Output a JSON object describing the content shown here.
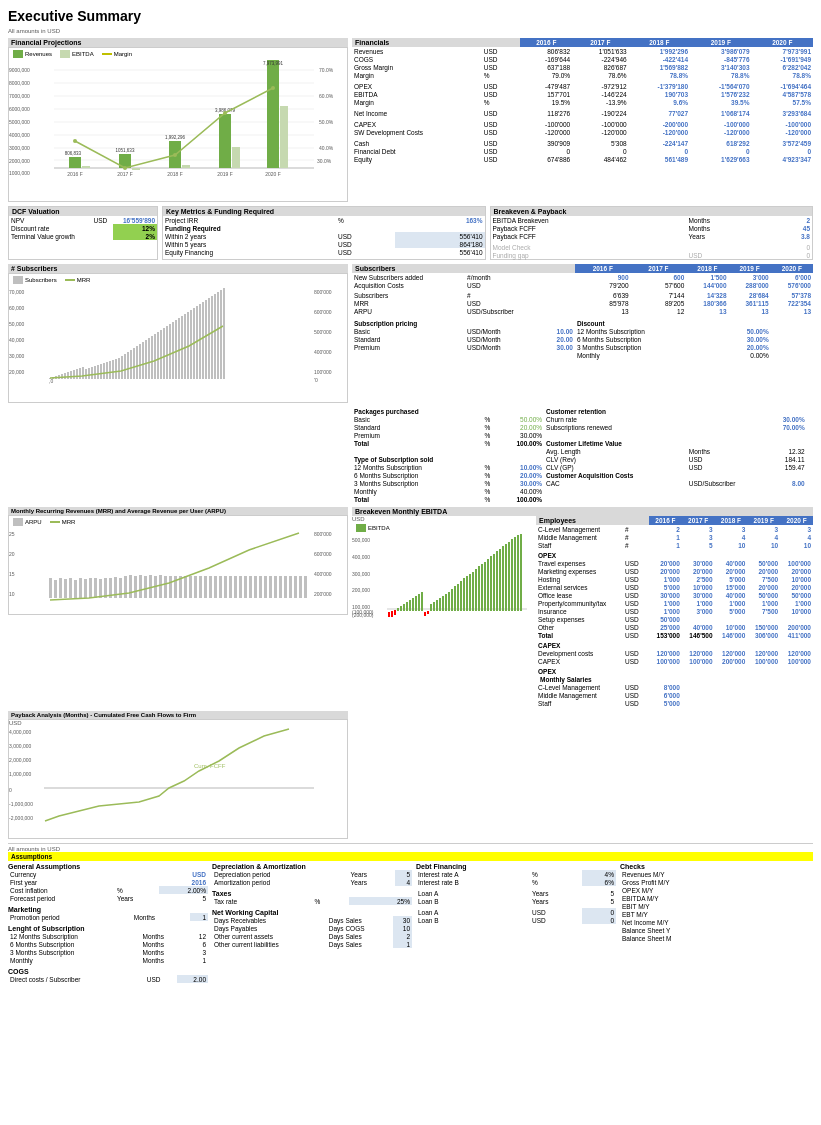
{
  "title": "Executive Summary",
  "currency_note": "All amounts in USD",
  "sections": {
    "financial_projections": {
      "label": "Financial Projections",
      "y_axis_label": "USD",
      "legend": [
        "Revenues",
        "EBITDA",
        "Margin"
      ],
      "bars": [
        {
          "year": "2016 F",
          "revenue": 806833,
          "ebitda": 157701,
          "margin": 19.5
        },
        {
          "year": "2017 F",
          "revenue": 1051633,
          "ebitda": -146224,
          "margin": -13.9
        },
        {
          "year": "2018 F",
          "revenue": 1992296,
          "ebitda": 190703,
          "margin": 9.6
        },
        {
          "year": "2019 F",
          "revenue": 3986079,
          "ebitda": 1576232,
          "margin": 39.5
        },
        {
          "year": "2020 F",
          "revenue": 7973991,
          "ebitda": 4587578,
          "margin": 57.5
        }
      ]
    },
    "financials": {
      "label": "Financials",
      "years": [
        "2016 F",
        "2017 F",
        "2018 F",
        "2019 F",
        "2020 F"
      ],
      "rows": [
        {
          "label": "Revenues",
          "unit": "USD",
          "values": [
            "806'832",
            "1'051'633",
            "1'992'296",
            "3'986'079",
            "7'973'991"
          ]
        },
        {
          "label": "COGS",
          "unit": "USD",
          "values": [
            "-169'644",
            "-224'946",
            "-422'414",
            "-845'776",
            "-1'691'949"
          ]
        },
        {
          "label": "Gross Margin",
          "unit": "USD",
          "values": [
            "637'188",
            "826'687",
            "1'569'882",
            "3'140'303",
            "6'282'042"
          ]
        },
        {
          "label": "Margin",
          "unit": "%",
          "values": [
            "79.0%",
            "78.6%",
            "78.8%",
            "78.8%",
            "78.8%"
          ]
        },
        {
          "label": "",
          "unit": "",
          "values": [
            "",
            "",
            "",
            "",
            ""
          ]
        },
        {
          "label": "OPEX",
          "unit": "USD",
          "values": [
            "-479'487",
            "-972'912",
            "-1'379'180",
            "-1'564'070",
            "-1'694'464"
          ]
        },
        {
          "label": "EBITDA",
          "unit": "USD",
          "values": [
            "157'701",
            "-146'224",
            "190'703",
            "1'576'232",
            "4'587'578"
          ]
        },
        {
          "label": "Margin",
          "unit": "%",
          "values": [
            "19.5%",
            "-13.9%",
            "9.6%",
            "39.5%",
            "57.5%"
          ]
        },
        {
          "label": "",
          "unit": "",
          "values": [
            "",
            "",
            "",
            "",
            ""
          ]
        },
        {
          "label": "Net Income",
          "unit": "USD",
          "values": [
            "118'276",
            "-190'224",
            "77'027",
            "1'068'174",
            "3'293'684"
          ]
        },
        {
          "label": "",
          "unit": "",
          "values": [
            "",
            "",
            "",
            "",
            ""
          ]
        },
        {
          "label": "CAPEX",
          "unit": "USD",
          "values": [
            "-100'000",
            "-100'000",
            "-200'000",
            "-100'000",
            "-100'000"
          ]
        },
        {
          "label": "SW Development Costs",
          "unit": "USD",
          "values": [
            "-120'000",
            "-120'000",
            "-120'000",
            "-120'000",
            "-120'000"
          ]
        },
        {
          "label": "",
          "unit": "",
          "values": [
            "",
            "",
            "",
            "",
            ""
          ]
        },
        {
          "label": "Cash",
          "unit": "USD",
          "values": [
            "390'909",
            "5'308",
            "-224'147",
            "618'292",
            "3'572'459"
          ]
        },
        {
          "label": "Financial Debt",
          "unit": "USD",
          "values": [
            "0",
            "0",
            "0",
            "0",
            "0"
          ]
        },
        {
          "label": "Equity",
          "unit": "USD",
          "values": [
            "674'886",
            "484'462",
            "561'489",
            "1'629'663",
            "4'923'347"
          ]
        }
      ]
    },
    "dcf": {
      "label": "DCF Valuation",
      "npv_label": "NPV",
      "npv_unit": "USD",
      "npv_value": "16'559'890",
      "discount_rate_label": "Discount rate",
      "discount_rate_value": "12%",
      "terminal_growth_label": "Terminal Value growth",
      "terminal_growth_value": "2%"
    },
    "key_metrics": {
      "label": "Key Metrics & Funding Required",
      "irr_label": "Project IRR",
      "irr_unit": "%",
      "irr_value": "163%",
      "funding_label": "Funding Required",
      "within2_label": "Within 2 years",
      "within2_unit": "USD",
      "within2_value": "556'410",
      "within5_label": "Within 5 years",
      "within5_unit": "USD",
      "within5_value": "864'180",
      "equity_label": "Equity Financing",
      "equity_unit": "USD",
      "equity_value": "556'410"
    },
    "breakeven": {
      "label": "Breakeven & Payback",
      "ebitda_breakeven_label": "EBITDA Breakeven",
      "ebitda_breakeven_unit": "Months",
      "ebitda_breakeven_value": "2",
      "payback_fcff_label": "Payback FCFF",
      "payback_fcff_unit": "Months",
      "payback_fcff_value": "45",
      "payback_fcff2_label": "Payback FCFF",
      "payback_fcff2_unit": "Years",
      "payback_fcff2_value": "3.8",
      "model_check_label": "Model Check",
      "model_check_value": "0",
      "funding_gap_label": "Funding gap",
      "funding_gap_unit": "USD",
      "funding_gap_value": "0"
    },
    "subscribers": {
      "label": "# Subscribers",
      "years": [
        "2016 F",
        "2017 F",
        "2018 F",
        "2019 F",
        "2020 F"
      ],
      "rows": [
        {
          "label": "New Subscribers added",
          "unit": "#/month",
          "values": [
            "900",
            "600",
            "1'500",
            "3'000",
            "6'000"
          ]
        },
        {
          "label": "Acquisition Costs",
          "unit": "USD",
          "values": [
            "79'200",
            "57'600",
            "144'000",
            "288'000",
            "576'000"
          ]
        },
        {
          "label": "",
          "unit": "",
          "values": [
            "",
            "",
            "",
            "",
            ""
          ]
        },
        {
          "label": "Subscribers",
          "unit": "#",
          "values": [
            "6'639",
            "7'144",
            "14'328",
            "28'684",
            "57'378"
          ]
        },
        {
          "label": "MRR",
          "unit": "USD",
          "values": [
            "85'978",
            "89'205",
            "180'366",
            "361'115",
            "722'354"
          ]
        },
        {
          "label": "ARPU",
          "unit": "USD/Subscriber",
          "values": [
            "13",
            "12",
            "13",
            "13",
            "13"
          ]
        }
      ]
    },
    "subscription_pricing": {
      "label": "Subscription pricing",
      "rows": [
        {
          "label": "Basic",
          "unit": "USD/Month",
          "value": "10.00"
        },
        {
          "label": "Standard",
          "unit": "USD/Month",
          "value": "20.00"
        },
        {
          "label": "Premium",
          "unit": "USD/Month",
          "value": "30.00"
        }
      ]
    },
    "packages_purchased": {
      "label": "Packages purchased",
      "rows": [
        {
          "label": "Basic",
          "unit": "%",
          "value": "50.00%"
        },
        {
          "label": "Standard",
          "unit": "%",
          "value": "20.00%"
        },
        {
          "label": "Premium",
          "unit": "%",
          "value": "30.00%"
        },
        {
          "label": "Total",
          "unit": "%",
          "value": "100.00%"
        }
      ]
    },
    "subscription_type": {
      "label": "Type of Subscription sold",
      "rows": [
        {
          "label": "12 Months Subscription",
          "unit": "%",
          "value": "10.00%"
        },
        {
          "label": "6 Months Subscription",
          "unit": "%",
          "value": "20.00%"
        },
        {
          "label": "3 Months Subscription",
          "unit": "%",
          "value": "30.00%"
        },
        {
          "label": "Monthly",
          "unit": "%",
          "value": "40.00%"
        },
        {
          "label": "Total",
          "unit": "%",
          "value": "100.00%"
        }
      ]
    },
    "discount": {
      "label": "Discount",
      "rows": [
        {
          "label": "12 Months Subscription",
          "value": "50.00%"
        },
        {
          "label": "6 Months Subscription",
          "value": "30.00%"
        },
        {
          "label": "3 Months Subscription",
          "value": "20.00%"
        },
        {
          "label": "Monthly",
          "value": "0.00%"
        }
      ]
    },
    "customer_retention": {
      "label": "Customer retention",
      "churn_label": "Churn rate",
      "churn_value": "30.00%",
      "renewed_label": "Subscriptions renewed",
      "renewed_value": "70.00%"
    },
    "customer_ltv": {
      "label": "Customer Lifetime Value",
      "avg_length_label": "Avg. Length",
      "avg_length_unit": "Months",
      "avg_length_value": "12.32",
      "clv_rev_label": "CLV (Rev)",
      "clv_rev_unit": "USD",
      "clv_rev_value": "184.11",
      "clv_gp_label": "CLV (GP)",
      "clv_gp_unit": "USD",
      "clv_gp_value": "159.47"
    },
    "customer_acquisition": {
      "label": "Customer Acquisition Costs",
      "cac_label": "CAC",
      "cac_unit": "USD/Subscriber",
      "cac_value": "8.00"
    },
    "mrr_arpu": {
      "label": "Monthly Recurring Revenues (MRR) and Average Revenue per User (ARPU)"
    },
    "breakeven_ebitda": {
      "label": "Breakeven Monthly EBITDA"
    },
    "payback_analysis": {
      "label": "Payback Analysis (Months) - Cumulated Free Cash Flows to Firm"
    },
    "opex_capex": {
      "label": "Breakeven Monthly EBITDA",
      "years": [
        "2016 F",
        "2017 F",
        "2018 F",
        "2019 F",
        "2020 F"
      ],
      "employees": {
        "label": "Employees",
        "rows": [
          {
            "label": "C-Level Management",
            "unit": "#",
            "values": [
              "2",
              "3",
              "3",
              "3",
              "3"
            ]
          },
          {
            "label": "Middle Management",
            "unit": "#",
            "values": [
              "1",
              "3",
              "4",
              "4",
              "4"
            ]
          },
          {
            "label": "Staff",
            "unit": "#",
            "values": [
              "1",
              "5",
              "10",
              "10",
              "10"
            ]
          }
        ]
      },
      "opex": {
        "label": "OPEX",
        "rows": [
          {
            "label": "Travel expenses",
            "unit": "USD",
            "values": [
              "20'000",
              "30'000",
              "40'000",
              "50'000",
              "100'000"
            ]
          },
          {
            "label": "Marketing expenses",
            "unit": "USD",
            "values": [
              "20'000",
              "20'000",
              "20'000",
              "20'000",
              "20'000"
            ]
          },
          {
            "label": "Hosting",
            "unit": "USD",
            "values": [
              "1'000",
              "2'500",
              "5'000",
              "7'500",
              "10'000"
            ]
          },
          {
            "label": "External services",
            "unit": "USD",
            "values": [
              "5'000",
              "10'000",
              "15'000",
              "20'000",
              "20'000"
            ]
          },
          {
            "label": "Office lease",
            "unit": "USD",
            "values": [
              "30'000",
              "30'000",
              "40'000",
              "50'000",
              "50'000"
            ]
          },
          {
            "label": "Property/community/tax",
            "unit": "USD",
            "values": [
              "1'000",
              "1'000",
              "1'000",
              "1'000",
              "1'000"
            ]
          },
          {
            "label": "Insurance",
            "unit": "USD",
            "values": [
              "1'000",
              "3'000",
              "5'000",
              "7'500",
              "10'000"
            ]
          },
          {
            "label": "Setup expenses",
            "unit": "USD",
            "values": [
              "50'000",
              "",
              "",
              "",
              ""
            ]
          },
          {
            "label": "Other",
            "unit": "USD",
            "values": [
              "25'000",
              "40'000",
              "10'000",
              "150'000",
              "200'000"
            ]
          },
          {
            "label": "Total",
            "unit": "USD",
            "values": [
              "153'000",
              "146'500",
              "146'000",
              "306'000",
              "411'000"
            ]
          }
        ]
      },
      "capex": {
        "label": "CAPEX",
        "rows": [
          {
            "label": "Development costs",
            "unit": "USD",
            "values": [
              "120'000",
              "120'000",
              "120'000",
              "120'000",
              "120'000"
            ]
          },
          {
            "label": "CAPEX",
            "unit": "USD",
            "values": [
              "100'000",
              "100'000",
              "200'000",
              "100'000",
              "100'000"
            ]
          }
        ]
      },
      "opex_salaries": {
        "label": "OPEX",
        "sublabel": "Monthly Salaries",
        "rows": [
          {
            "label": "C-Level Management",
            "unit": "USD",
            "values": [
              "8'000",
              "",
              "",
              "",
              ""
            ]
          },
          {
            "label": "Middle Management",
            "unit": "USD",
            "values": [
              "6'000",
              "",
              "",
              "",
              ""
            ]
          },
          {
            "label": "Staff",
            "unit": "USD",
            "values": [
              "5'000",
              "",
              "",
              "",
              ""
            ]
          }
        ]
      }
    }
  },
  "assumptions": {
    "label": "Assumptions",
    "currency_note": "All amounts in USD",
    "general": {
      "label": "General Assumptions",
      "rows": [
        {
          "label": "Currency",
          "value": "USD",
          "is_input": true
        },
        {
          "label": "First year",
          "value": "2016",
          "is_input": true
        },
        {
          "label": "Cost inflation",
          "unit": "%",
          "value": "2.00%",
          "is_input": true
        },
        {
          "label": "Forecast period",
          "unit": "Years",
          "value": "5"
        }
      ]
    },
    "marketing": {
      "label": "Marketing",
      "rows": [
        {
          "label": "Promotion period",
          "unit": "Months",
          "value": "1",
          "is_input": true
        }
      ]
    },
    "subscription_length": {
      "label": "Lenght of Subscription",
      "rows": [
        {
          "label": "12 Months Subscription",
          "unit": "Months",
          "value": "12"
        },
        {
          "label": "6 Months Subscription",
          "unit": "Months",
          "value": "6"
        },
        {
          "label": "3 Months Subscription",
          "unit": "Months",
          "value": "3"
        },
        {
          "label": "Monthly",
          "unit": "Months",
          "value": "1"
        }
      ]
    },
    "cogs": {
      "label": "COGS",
      "rows": [
        {
          "label": "Direct costs / Subscriber",
          "unit": "USD",
          "value": "2.00",
          "is_input": true
        }
      ]
    },
    "depreciation": {
      "label": "Depreciation & Amortization",
      "rows": [
        {
          "label": "Depreciation period",
          "unit": "Years",
          "value": "5",
          "is_input": true
        },
        {
          "label": "Amortization period",
          "unit": "Years",
          "value": "4",
          "is_input": true
        }
      ]
    },
    "taxes": {
      "label": "Taxes",
      "rows": [
        {
          "label": "Tax rate",
          "unit": "%",
          "value": "25%",
          "is_input": true
        }
      ]
    },
    "net_working_capital": {
      "label": "Net Working Capital",
      "rows": [
        {
          "label": "Days Receivables",
          "unit": "Days Sales",
          "value": "30",
          "is_input": true
        },
        {
          "label": "Days Payables",
          "unit": "Days COGS",
          "value": "10",
          "is_input": true
        },
        {
          "label": "Other current assets",
          "unit": "Days Sales",
          "value": "2",
          "is_input": true
        },
        {
          "label": "Other current liabilities",
          "unit": "Days Sales",
          "value": "1",
          "is_input": true
        }
      ]
    },
    "debt_financing": {
      "label": "Debt Financing",
      "rows": [
        {
          "label": "Interest rate A",
          "unit": "%",
          "value": "4%",
          "is_input": true
        },
        {
          "label": "Interest rate B",
          "unit": "%",
          "value": "6%",
          "is_input": true
        }
      ],
      "loans": [
        {
          "label": "Loan A",
          "unit": "Years",
          "value": "5"
        },
        {
          "label": "Loan B",
          "unit": "Years",
          "value": "5"
        },
        {
          "label": "Loan A",
          "unit": "USD",
          "value": "0",
          "is_input": true
        },
        {
          "label": "Loan B",
          "unit": "USD",
          "value": "0",
          "is_input": true
        }
      ]
    },
    "checks": {
      "label": "Checks",
      "rows": [
        {
          "label": "Revenues M/Y"
        },
        {
          "label": "Gross Profit M/Y"
        },
        {
          "label": "OPEX M/Y"
        },
        {
          "label": "EBITDA M/Y"
        },
        {
          "label": "EBIT M/Y"
        },
        {
          "label": "EBT M/Y"
        },
        {
          "label": "Net Income M/Y"
        },
        {
          "label": "Balance Sheet Y"
        },
        {
          "label": "Balance Sheet M"
        }
      ]
    }
  }
}
